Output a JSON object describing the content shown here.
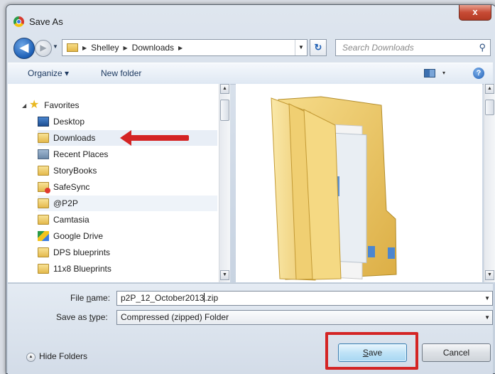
{
  "window": {
    "title": "Save As",
    "close_glyph": "x"
  },
  "nav": {
    "back_glyph": "◀",
    "forward_glyph": "▶",
    "path": [
      "Shelley",
      "Downloads"
    ],
    "refresh_glyph": "↻",
    "search_placeholder": "Search Downloads"
  },
  "toolbar": {
    "organize": "Organize ▾",
    "new_folder": "New folder",
    "views_dd": "▾",
    "help": "?"
  },
  "sidebar": {
    "favorites": "Favorites",
    "items": [
      {
        "label": "Desktop",
        "icon": "desktop-icon"
      },
      {
        "label": "Downloads",
        "icon": "downloads-folder-icon",
        "selected": true
      },
      {
        "label": "Recent Places",
        "icon": "recent-places-icon"
      },
      {
        "label": "StoryBooks",
        "icon": "folder-icon"
      },
      {
        "label": "SafeSync",
        "icon": "safesync-folder-icon"
      },
      {
        "label": "@P2P",
        "icon": "folder-icon"
      },
      {
        "label": "Camtasia",
        "icon": "folder-icon"
      },
      {
        "label": "Google Drive",
        "icon": "google-drive-icon"
      },
      {
        "label": "DPS blueprints",
        "icon": "folder-icon"
      },
      {
        "label": "11x8 Blueprints",
        "icon": "folder-icon"
      }
    ]
  },
  "form": {
    "filename_label_pre": "File ",
    "filename_label_u": "n",
    "filename_label_post": "ame:",
    "filename_value_pre": "p2P_12_October2013",
    "filename_value_post": ".zip",
    "type_label_pre": "Save as ",
    "type_label_u": "t",
    "type_label_post": "ype:",
    "type_value": "Compressed (zipped) Folder"
  },
  "footer": {
    "hide_folders": "Hide Folders",
    "save_u": "S",
    "save_rest": "ave",
    "cancel": "Cancel"
  },
  "colors": {
    "annotation": "#d42424",
    "accent": "#1f5fb6"
  }
}
